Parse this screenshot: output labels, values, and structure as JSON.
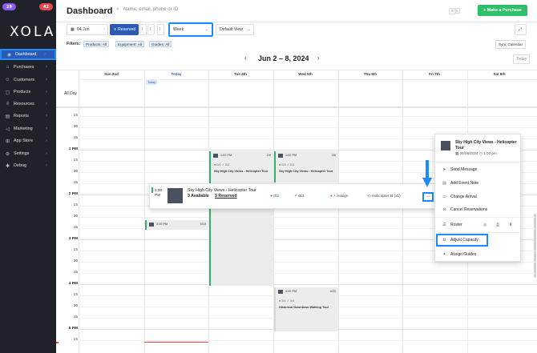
{
  "sidebar": {
    "badges": [
      {
        "text": "29",
        "color": "#8b5cf6"
      },
      {
        "text": "42",
        "color": "#e5484d"
      }
    ],
    "logo": "XOLA",
    "items": [
      {
        "label": "Dashboard",
        "icon": "dashboard-icon",
        "active": true
      },
      {
        "label": "Purchases",
        "icon": "cart-icon"
      },
      {
        "label": "Customers",
        "icon": "people-icon"
      },
      {
        "label": "Products",
        "icon": "box-icon"
      },
      {
        "label": "Resources",
        "icon": "layers-icon"
      },
      {
        "label": "Reports",
        "icon": "chart-icon"
      },
      {
        "label": "Marketing",
        "icon": "megaphone-icon"
      },
      {
        "label": "App Store",
        "icon": "store-icon"
      },
      {
        "label": "Settings",
        "icon": "gear-icon"
      },
      {
        "label": "Debug",
        "icon": "bug-icon"
      }
    ]
  },
  "header": {
    "title": "Dashboard",
    "search_placeholder": "Name, email, phone or ID",
    "kbd": "K",
    "purchase_label": "+ Make a Purchase"
  },
  "toolbar": {
    "date": "04 Jun",
    "reserved": "Reserved",
    "view": "Week",
    "default_view": "Default View"
  },
  "filters": {
    "label": "Filters:",
    "chips": [
      "Products: All",
      "Equipment: All",
      "Guides: All"
    ],
    "sync": "Sync Calendar"
  },
  "calendar": {
    "month_title": "Jun 2 – 8, 2024",
    "today_button": "Today",
    "days": [
      "Sun 2nd",
      "Today",
      "Tue 4th",
      "Wed 5th",
      "Thu 6th",
      "Fri 7th",
      "Sat 8th"
    ],
    "today_tag": "Today",
    "all_day": "All Day",
    "times": [
      {
        "label": "15",
        "bold": false
      },
      {
        "label": "30",
        "bold": false
      },
      {
        "label": "45",
        "bold": false
      },
      {
        "label": "1 PM",
        "bold": true
      },
      {
        "label": "15",
        "bold": false
      },
      {
        "label": "30",
        "bold": false
      },
      {
        "label": "45",
        "bold": false
      },
      {
        "label": "2 PM",
        "bold": true
      },
      {
        "label": "15",
        "bold": false
      },
      {
        "label": "30",
        "bold": false
      },
      {
        "label": "45",
        "bold": false
      },
      {
        "label": "3 PM",
        "bold": true
      },
      {
        "label": "15",
        "bold": false
      },
      {
        "label": "30",
        "bold": false
      },
      {
        "label": "45",
        "bold": false
      },
      {
        "label": "4 PM",
        "bold": true
      },
      {
        "label": "15",
        "bold": false
      },
      {
        "label": "30",
        "bold": false
      },
      {
        "label": "45",
        "bold": false
      },
      {
        "label": "5 PM",
        "bold": true
      },
      {
        "label": "15",
        "bold": false
      }
    ],
    "events": [
      {
        "time": "1:00 PM",
        "count": "2/8",
        "title": "Sky High City Views - Helicopter Tour",
        "meta1": "0/2",
        "meta2": "0/2"
      },
      {
        "time": "1:00 PM",
        "count": "3/8",
        "title": "Sky High City Views - Helicopter Tour",
        "meta1": "0/3",
        "meta2": "0/3"
      },
      {
        "time": "3:30 PM",
        "count": "5/10"
      },
      {
        "time": "4:00 PM",
        "count": "4/20",
        "title": "Historical Downtown Walking Tour",
        "meta1": "3/4",
        "meta2": "0/4"
      }
    ]
  },
  "popup": {
    "time": "1:00",
    "time2": "PM",
    "title": "Sky High City Views - Helicopter Tour",
    "available": "3 Available",
    "reserved": "3 Reserved",
    "m1": "0/3",
    "m2": "0/3",
    "assign": "+ Assign",
    "resource": "Helicopter B (x1)",
    "more": "···"
  },
  "context_menu": {
    "title": "Sky High City Views - Helicopter Tour",
    "date": "06/05/2024",
    "time": "1:00 pm",
    "items": [
      "Send Message",
      "Add Event Note",
      "Change Arrival",
      "Cancel Reservations",
      "Roster",
      "Adjust Capacity",
      "Assign Guides"
    ]
  }
}
